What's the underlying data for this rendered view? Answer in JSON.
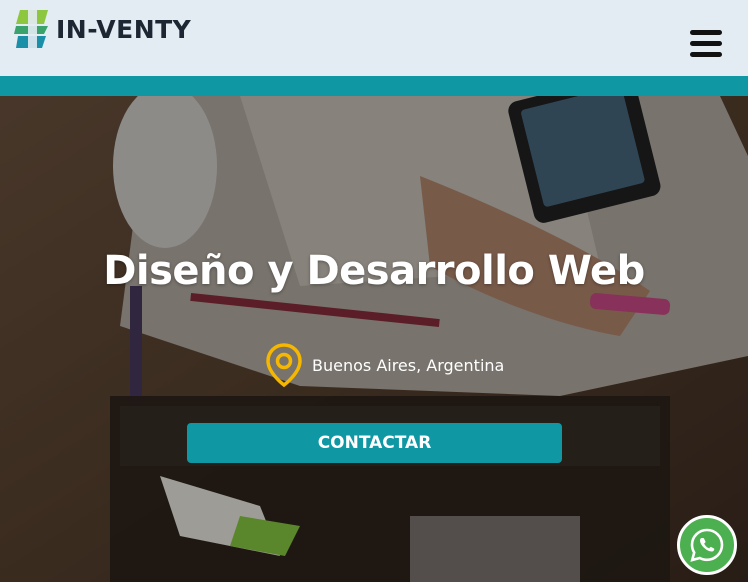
{
  "brand": {
    "name": "IN-VENTY",
    "colors": {
      "teal": "#0f97a4",
      "green": "#7cc242",
      "header_bg": "#e3ebf3"
    }
  },
  "nav": {
    "menu_icon": "hamburger-icon"
  },
  "hero": {
    "title": "Diseño y Desarrollo Web",
    "location": "Buenos Aires, Argentina",
    "location_icon": "map-pin-icon",
    "location_icon_color": "#f5b700",
    "cta_label": "CONTACTAR"
  },
  "floating": {
    "whatsapp_icon": "whatsapp-icon"
  }
}
